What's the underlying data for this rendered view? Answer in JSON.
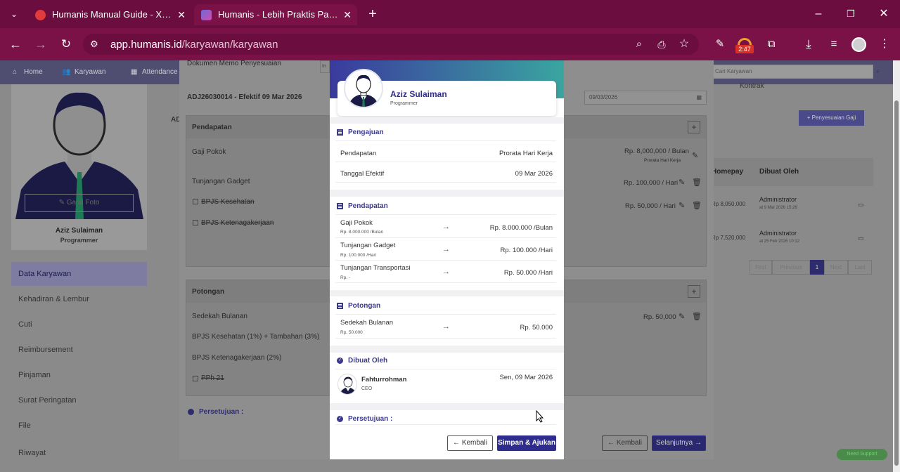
{
  "browser": {
    "tabs": [
      {
        "label": "Humanis Manual Guide - Xminc",
        "active": false
      },
      {
        "label": "Humanis - Lebih Praktis Pakai Hu",
        "active": true
      }
    ],
    "url_domain": "app.humanis.id",
    "url_path": "/karyawan/karyawan",
    "extension_badge": "2:47",
    "icons": [
      "tab-search-icon",
      "back-icon",
      "forward-icon",
      "reload-icon",
      "site-info-icon",
      "zoom-icon",
      "install-icon",
      "bookmark-star-icon",
      "extension-icon",
      "puzzle-icon",
      "download-icon",
      "media-icon",
      "profile-icon",
      "menu-icon"
    ]
  },
  "top_nav": {
    "items": [
      "Home",
      "Karyawan",
      "Attendance"
    ],
    "search_placeholder": "Cari Karyawan"
  },
  "employee_sidebar": {
    "change_photo_label": "Ganti Foto",
    "name": "Aziz Sulaiman",
    "position": "Programmer",
    "menu": [
      {
        "label": "Data Karyawan",
        "selected": true
      },
      {
        "label": "Kehadiran & Lembur",
        "selected": false
      },
      {
        "label": "Cuti",
        "selected": false
      },
      {
        "label": "Reimbursement",
        "selected": false
      },
      {
        "label": "Pinjaman",
        "selected": false
      },
      {
        "label": "Surat Peringatan",
        "selected": false
      },
      {
        "label": "File",
        "selected": false
      },
      {
        "label": "Riwayat",
        "selected": false
      }
    ]
  },
  "background_page": {
    "tab_right": "Kontrak",
    "adjust_button": "Penyesuaian Gaji",
    "col_homepay": "Homepay",
    "col_created_by": "Dibuat Oleh",
    "rows": [
      {
        "pay": "Rp 8,050,000",
        "by": "Administrator",
        "at": "at 9 Mar 2026 15:26"
      },
      {
        "pay": "Rp 7,520,000",
        "by": "Administrator",
        "at": "at 25 Feb 2026 10:12"
      }
    ],
    "pagination": [
      "First",
      "Previous",
      "1",
      "Next",
      "Last"
    ],
    "support_button": "Need Support"
  },
  "adjust_form": {
    "memo_label": "Dokumen Memo Penyesuaian",
    "memo_input_prefix": "In",
    "code_line": "ADJ26030014 - Efektif 09 Mar 2026",
    "date_value": "09/03/2026",
    "side_code_fragment": "AD",
    "income_title": "Pendapatan",
    "income_rows": [
      {
        "label": "Gaji Pokok",
        "value": "Rp. 8,000,000 / Bulan",
        "sub": "Prorata Hari Kerja",
        "checkbox": false
      },
      {
        "label": "Tunjangan Gadget",
        "value": "Rp. 100,000 / Hari",
        "checkbox": false
      },
      {
        "label": "BPJS Kesehatan",
        "value": "Rp. 50,000 / Hari",
        "checkbox": true
      },
      {
        "label": "BPJS Ketenagakerjaan",
        "value": "",
        "checkbox": true
      }
    ],
    "deduction_title": "Potongan",
    "deduction_rows": [
      {
        "label": "Sedekah Bulanan",
        "value": "Rp. 50,000",
        "checkbox": false
      },
      {
        "label": "BPJS Kesehatan (1%) + Tambahan (3%)",
        "value": "",
        "checkbox": false
      },
      {
        "label": "BPJS Ketenagakerjaan (2%)",
        "value": "",
        "checkbox": false
      },
      {
        "label": "PPh 21",
        "value": "",
        "checkbox": true
      }
    ],
    "approval_label": "Persetujuan :",
    "back_button": "Kembali",
    "next_button": "Selanjutnya"
  },
  "modal": {
    "employee_name": "Aziz Sulaiman",
    "employee_position": "Programmer",
    "submission": {
      "title": "Pengajuan",
      "rows": [
        {
          "label": "Pendapatan",
          "value": "Prorata Hari Kerja"
        },
        {
          "label": "Tanggal Efektif",
          "value": "09 Mar 2026"
        }
      ]
    },
    "income": {
      "title": "Pendapatan",
      "rows": [
        {
          "label": "Gaji Pokok",
          "old": "Rp. 8.000.000 /Bulan",
          "new": "Rp. 8.000.000 /Bulan"
        },
        {
          "label": "Tunjangan Gadget",
          "old": "Rp. 100.000 /Hari",
          "new": "Rp. 100.000 /Hari"
        },
        {
          "label": "Tunjangan Transportasi",
          "old": "Rp. -",
          "new": "Rp. 50.000 /Hari"
        }
      ]
    },
    "deduction": {
      "title": "Potongan",
      "rows": [
        {
          "label": "Sedekah Bulanan",
          "old": "Rp. 50.000",
          "new": "Rp. 50.000"
        }
      ]
    },
    "created_by": {
      "title": "Dibuat Oleh",
      "name": "Fahturrohman",
      "role": "CEO",
      "date": "Sen, 09 Mar 2026"
    },
    "approval_title": "Persetujuan :",
    "back_button": "Kembali",
    "submit_button": "Simpan & Ajukan"
  },
  "colors": {
    "browser_frame": "#7a1248",
    "primary": "#2e2c8c",
    "heading": "#3b3a8c",
    "header_gradient_start": "#3a3a9e",
    "header_gradient_end": "#3aa5a0"
  }
}
